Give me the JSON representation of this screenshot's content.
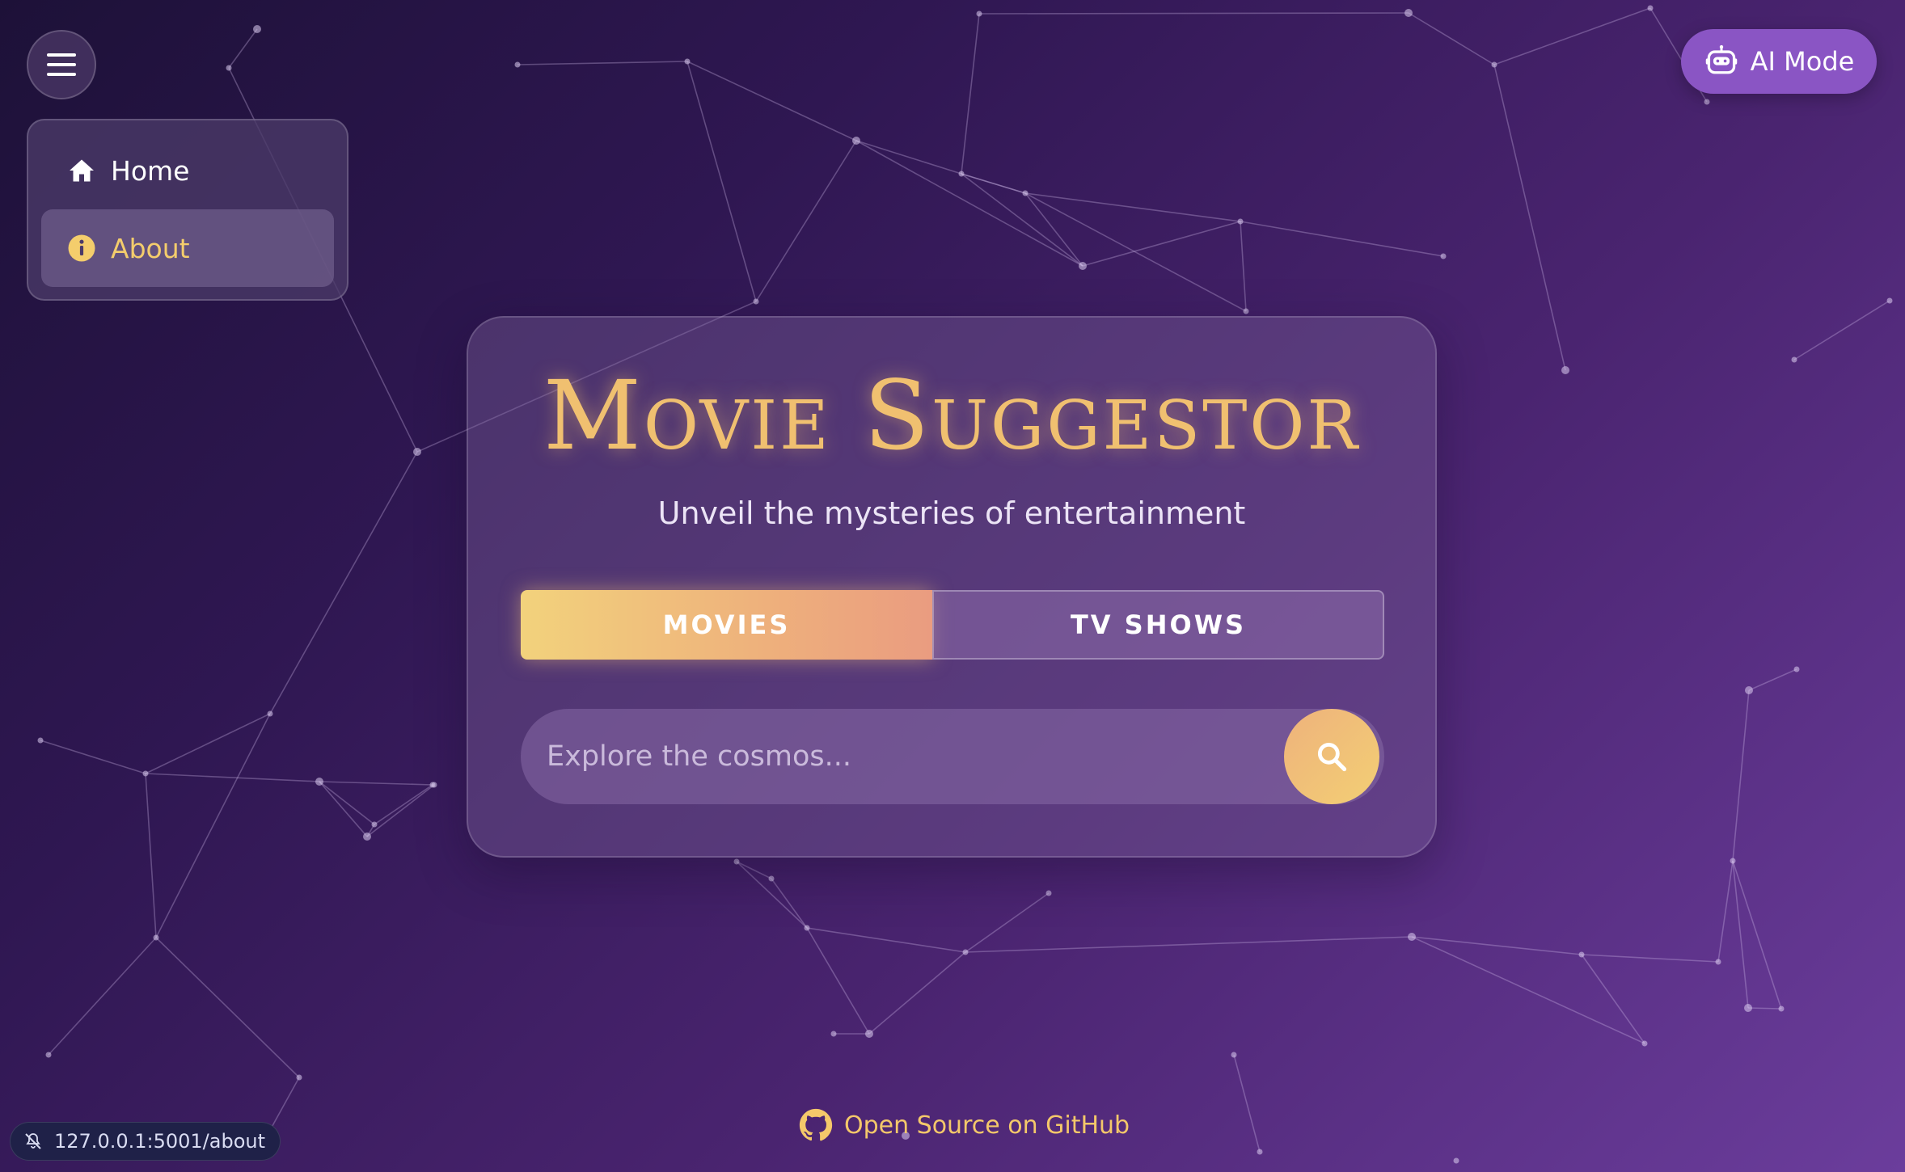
{
  "nav": {
    "menu_icon": "hamburger-icon",
    "items": [
      {
        "label": "Home",
        "icon": "home-icon",
        "active": false
      },
      {
        "label": "About",
        "icon": "info-icon",
        "active": true
      }
    ]
  },
  "ai_mode": {
    "label": "AI Mode",
    "icon": "robot-icon"
  },
  "hero": {
    "title": "Movie Suggestor",
    "subtitle": "Unveil the mysteries of entertainment"
  },
  "toggle": {
    "options": [
      {
        "label": "MOVIES",
        "selected": true
      },
      {
        "label": "TV SHOWS",
        "selected": false
      }
    ]
  },
  "search": {
    "placeholder": "Explore the cosmos...",
    "value": "",
    "button_icon": "search-icon"
  },
  "footer": {
    "link_label": "Open Source on GitHub",
    "icon": "github-icon"
  },
  "status_bar": {
    "url": "127.0.0.1:5001/about",
    "icon": "bell-slash-icon"
  },
  "colors": {
    "accent_gold": "#f4c86a",
    "title_gold": "#f0c070",
    "ai_purple": "#8a55c4",
    "bg_dark": "#1d1138",
    "bg_light": "#6b3d9c"
  }
}
